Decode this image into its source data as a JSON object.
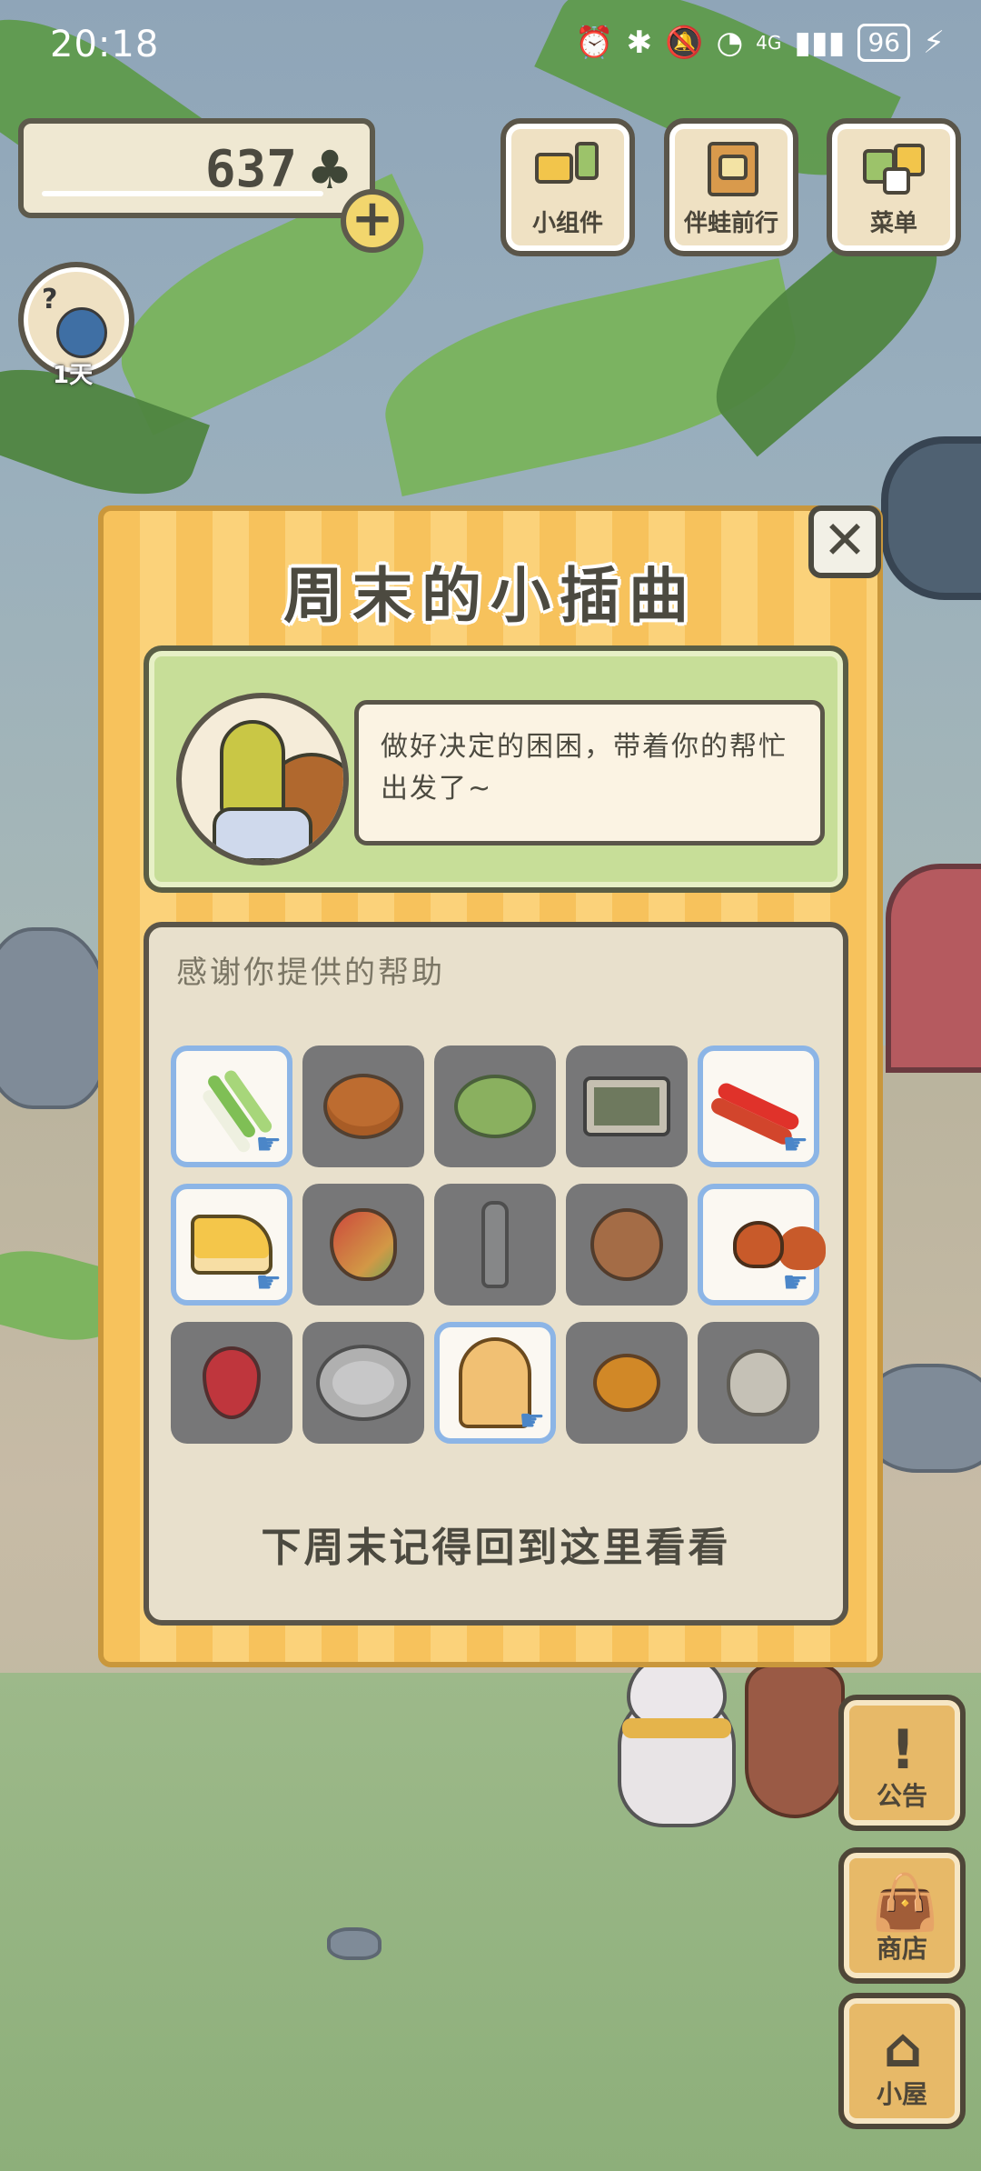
{
  "status_bar": {
    "time": "20:18",
    "network": "4G",
    "battery": "96"
  },
  "clovers": {
    "amount": "637"
  },
  "top_buttons": {
    "widgets": "小组件",
    "travel_with_frog": "伴蛙前行",
    "menu": "菜单"
  },
  "avatar": {
    "day_label": "1天"
  },
  "side_buttons": {
    "notice": "公告",
    "shop": "商店",
    "hut": "小屋"
  },
  "dialog": {
    "title": "周末的小插曲",
    "close_glyph": "✕",
    "story_text": "做好决定的困困，带着你的帮忙出发了~",
    "items_heading": "感谢你提供的帮助",
    "footer": "下周末记得回到这里看看",
    "items": [
      {
        "icon": "green-onion-icon",
        "given": true
      },
      {
        "icon": "persimmon-icon",
        "given": false
      },
      {
        "icon": "cabbage-icon",
        "given": false
      },
      {
        "icon": "bento-box-icon",
        "given": false
      },
      {
        "icon": "chili-pepper-icon",
        "given": true
      },
      {
        "icon": "cheese-icon",
        "given": true
      },
      {
        "icon": "mango-icon",
        "given": false
      },
      {
        "icon": "bottle-icon",
        "given": false
      },
      {
        "icon": "onion-icon",
        "given": false
      },
      {
        "icon": "chestnut-icon",
        "given": true
      },
      {
        "icon": "strawberry-icon",
        "given": false
      },
      {
        "icon": "salad-plate-icon",
        "given": false
      },
      {
        "icon": "popcorn-icon",
        "given": true
      },
      {
        "icon": "orange-icon",
        "given": false
      },
      {
        "icon": "garlic-icon",
        "given": false
      }
    ]
  },
  "colors": {
    "dialog_stripe": "#f7c25c",
    "story_card": "#c7de98",
    "given_item_border": "#8cb5e6",
    "locked_item": "#777778"
  }
}
